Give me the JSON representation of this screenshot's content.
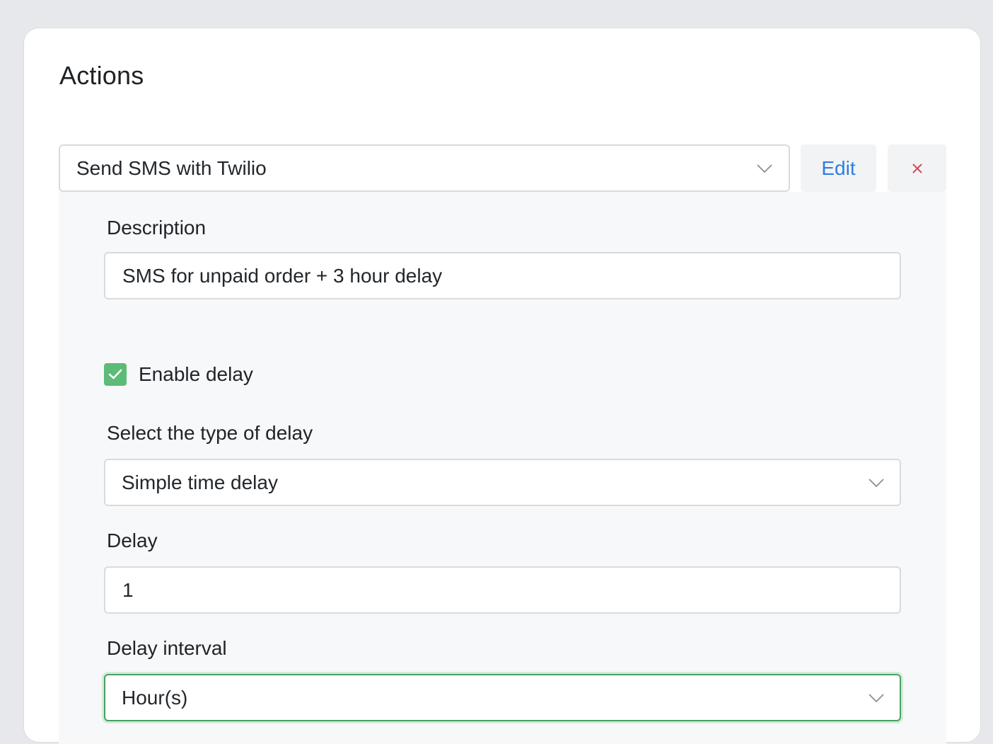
{
  "section": {
    "title": "Actions"
  },
  "action": {
    "selected": "Send SMS with Twilio",
    "edit_label": "Edit",
    "remove_label": "×"
  },
  "form": {
    "description": {
      "label": "Description",
      "value": "SMS for unpaid order + 3 hour delay"
    },
    "enable_delay": {
      "label": "Enable delay",
      "checked": true
    },
    "delay_type": {
      "label": "Select the type of delay",
      "value": "Simple time delay"
    },
    "delay": {
      "label": "Delay",
      "value": "1"
    },
    "delay_interval": {
      "label": "Delay interval",
      "value": "Hour(s)"
    }
  },
  "colors": {
    "accent_link": "#2f7de1",
    "remove": "#d94a5a",
    "checkbox": "#5dbb78",
    "focus_border": "#4aa063"
  }
}
